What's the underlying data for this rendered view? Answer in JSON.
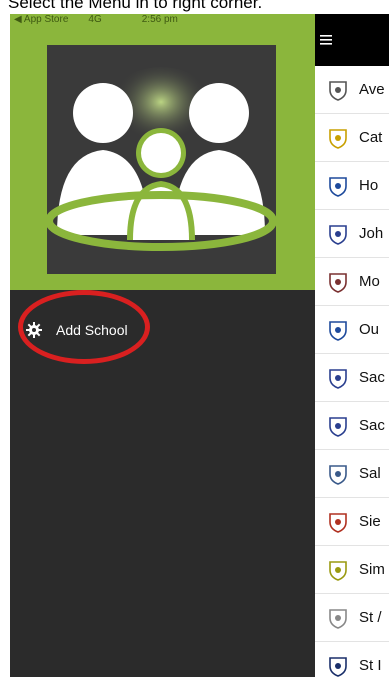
{
  "caption": "Select the Menu in to right corner.",
  "status_bar": {
    "carrier": "◀ App Store",
    "network": "4G",
    "time": "2:56 pm"
  },
  "drawer": {
    "menu_items": [
      {
        "label": "Add School",
        "icon": "gear-icon"
      }
    ]
  },
  "header": {
    "menu_icon": "hamburger-icon"
  },
  "schools": [
    {
      "name": "Ave",
      "icon": "crest-icon"
    },
    {
      "name": "Cat",
      "icon": "crest-icon"
    },
    {
      "name": "Ho",
      "icon": "crest-icon"
    },
    {
      "name": "Joh",
      "icon": "crest-icon"
    },
    {
      "name": "Mo",
      "icon": "crest-icon"
    },
    {
      "name": "Ou",
      "icon": "crest-icon"
    },
    {
      "name": "Sac",
      "icon": "crest-icon"
    },
    {
      "name": "Sac",
      "icon": "crest-icon"
    },
    {
      "name": "Sal",
      "icon": "crest-icon"
    },
    {
      "name": "Sie",
      "icon": "crest-icon"
    },
    {
      "name": "Sim",
      "icon": "crest-icon"
    },
    {
      "name": "St /",
      "icon": "crest-icon"
    },
    {
      "name": "St I",
      "icon": "crest-icon"
    }
  ],
  "colors": {
    "accent_green": "#8bb63c",
    "drawer_bg": "#2b2b2b",
    "highlight_red": "#d92020"
  }
}
